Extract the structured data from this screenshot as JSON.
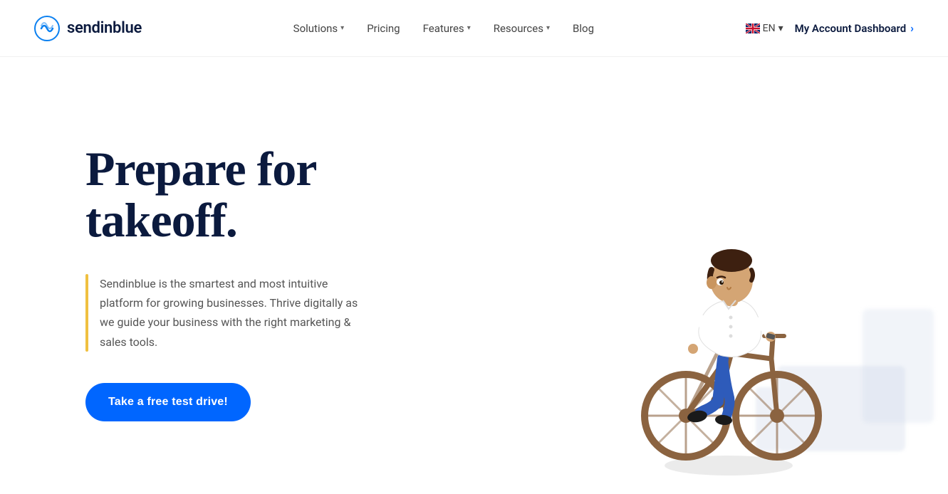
{
  "brand": {
    "name": "sendinblue",
    "logo_alt": "Sendinblue logo"
  },
  "nav": {
    "items": [
      {
        "label": "Solutions",
        "has_dropdown": true
      },
      {
        "label": "Pricing",
        "has_dropdown": false
      },
      {
        "label": "Features",
        "has_dropdown": true
      },
      {
        "label": "Resources",
        "has_dropdown": true
      },
      {
        "label": "Blog",
        "has_dropdown": false
      }
    ]
  },
  "header": {
    "lang_label": "EN",
    "lang_arrow": "▾",
    "account_label": "My Account Dashboard",
    "account_chevron": "›"
  },
  "hero": {
    "title": "Prepare for takeoff.",
    "description": "Sendinblue is the smartest and most intuitive platform for growing businesses. Thrive digitally as we guide your business with the right marketing & sales tools.",
    "cta_label": "Take a free test drive!"
  },
  "colors": {
    "brand_blue": "#0b1a3e",
    "cta_blue": "#0066ff",
    "accent_yellow": "#f0c040"
  }
}
